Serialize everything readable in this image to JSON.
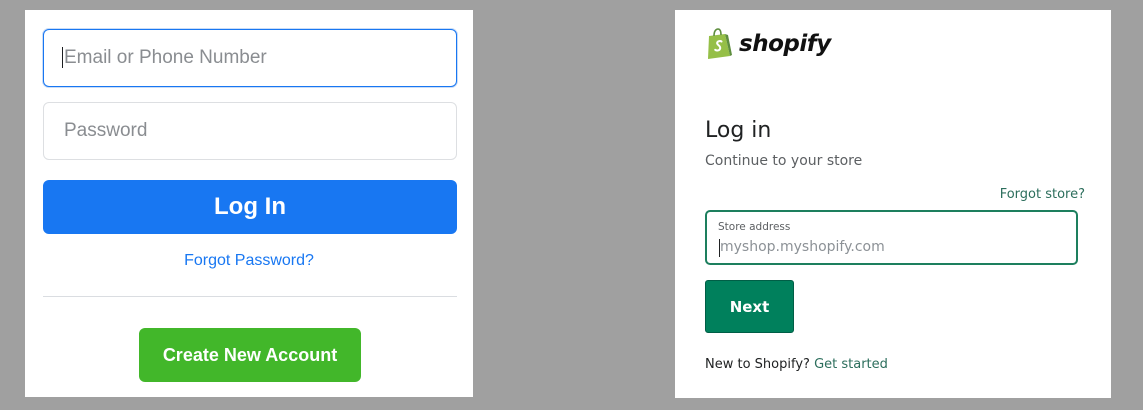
{
  "facebook": {
    "email_placeholder": "Email or Phone Number",
    "password_placeholder": "Password",
    "login_label": "Log In",
    "forgot_password": "Forgot Password?",
    "create_account_label": "Create New Account",
    "colors": {
      "primary": "#1877f2",
      "create": "#42b72a"
    }
  },
  "shopify": {
    "logo_icon": "shopify-bag-icon",
    "logo_text": "shopify",
    "title": "Log in",
    "subtitle": "Continue to your store",
    "forgot_store": "Forgot store?",
    "store_field": {
      "label": "Store address",
      "placeholder": "myshop.myshopify.com",
      "value": ""
    },
    "next_label": "Next",
    "footer_text": "New to Shopify?",
    "get_started": "Get started",
    "colors": {
      "accent": "#00805c",
      "logo_green": "#95bf47"
    }
  }
}
